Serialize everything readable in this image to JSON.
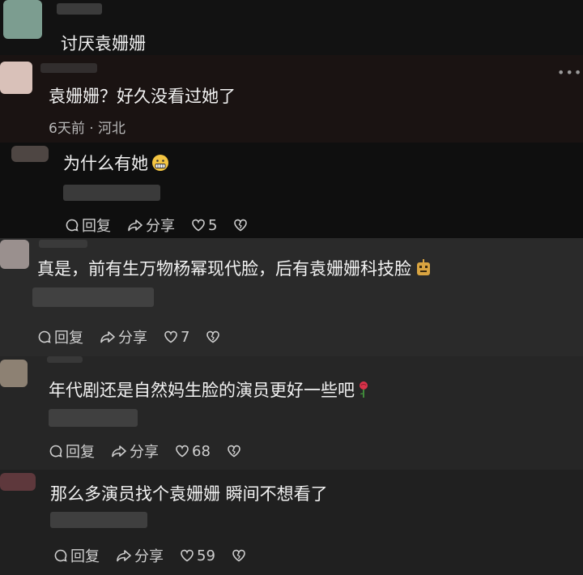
{
  "top_comment": {
    "text": "讨厌袁姗姗"
  },
  "comments": [
    {
      "text": "袁姗姗？好久没看过她了",
      "meta": "6天前 · 河北"
    },
    {
      "text": "为什么有她",
      "emoji": "grimacing-face-icon",
      "actions": {
        "reply": "回复",
        "share": "分享",
        "likes": "5"
      }
    },
    {
      "text": "真是，前有生万物杨幂现代脸，后有袁姗姗科技脸",
      "emoji": "robot-face-icon",
      "actions": {
        "reply": "回复",
        "share": "分享",
        "likes": "7"
      }
    },
    {
      "text": "年代剧还是自然妈生脸的演员更好一些吧",
      "emoji": "rose-icon",
      "actions": {
        "reply": "回复",
        "share": "分享",
        "likes": "68"
      }
    },
    {
      "text": "那么多演员找个袁姗姗 瞬间不想看了",
      "actions": {
        "reply": "回复",
        "share": "分享",
        "likes": "59"
      }
    }
  ],
  "more_icon": "more-dots-icon",
  "colors": {
    "background": "#151515",
    "text": "#f2f2f2",
    "meta": "#b9b9b9"
  }
}
